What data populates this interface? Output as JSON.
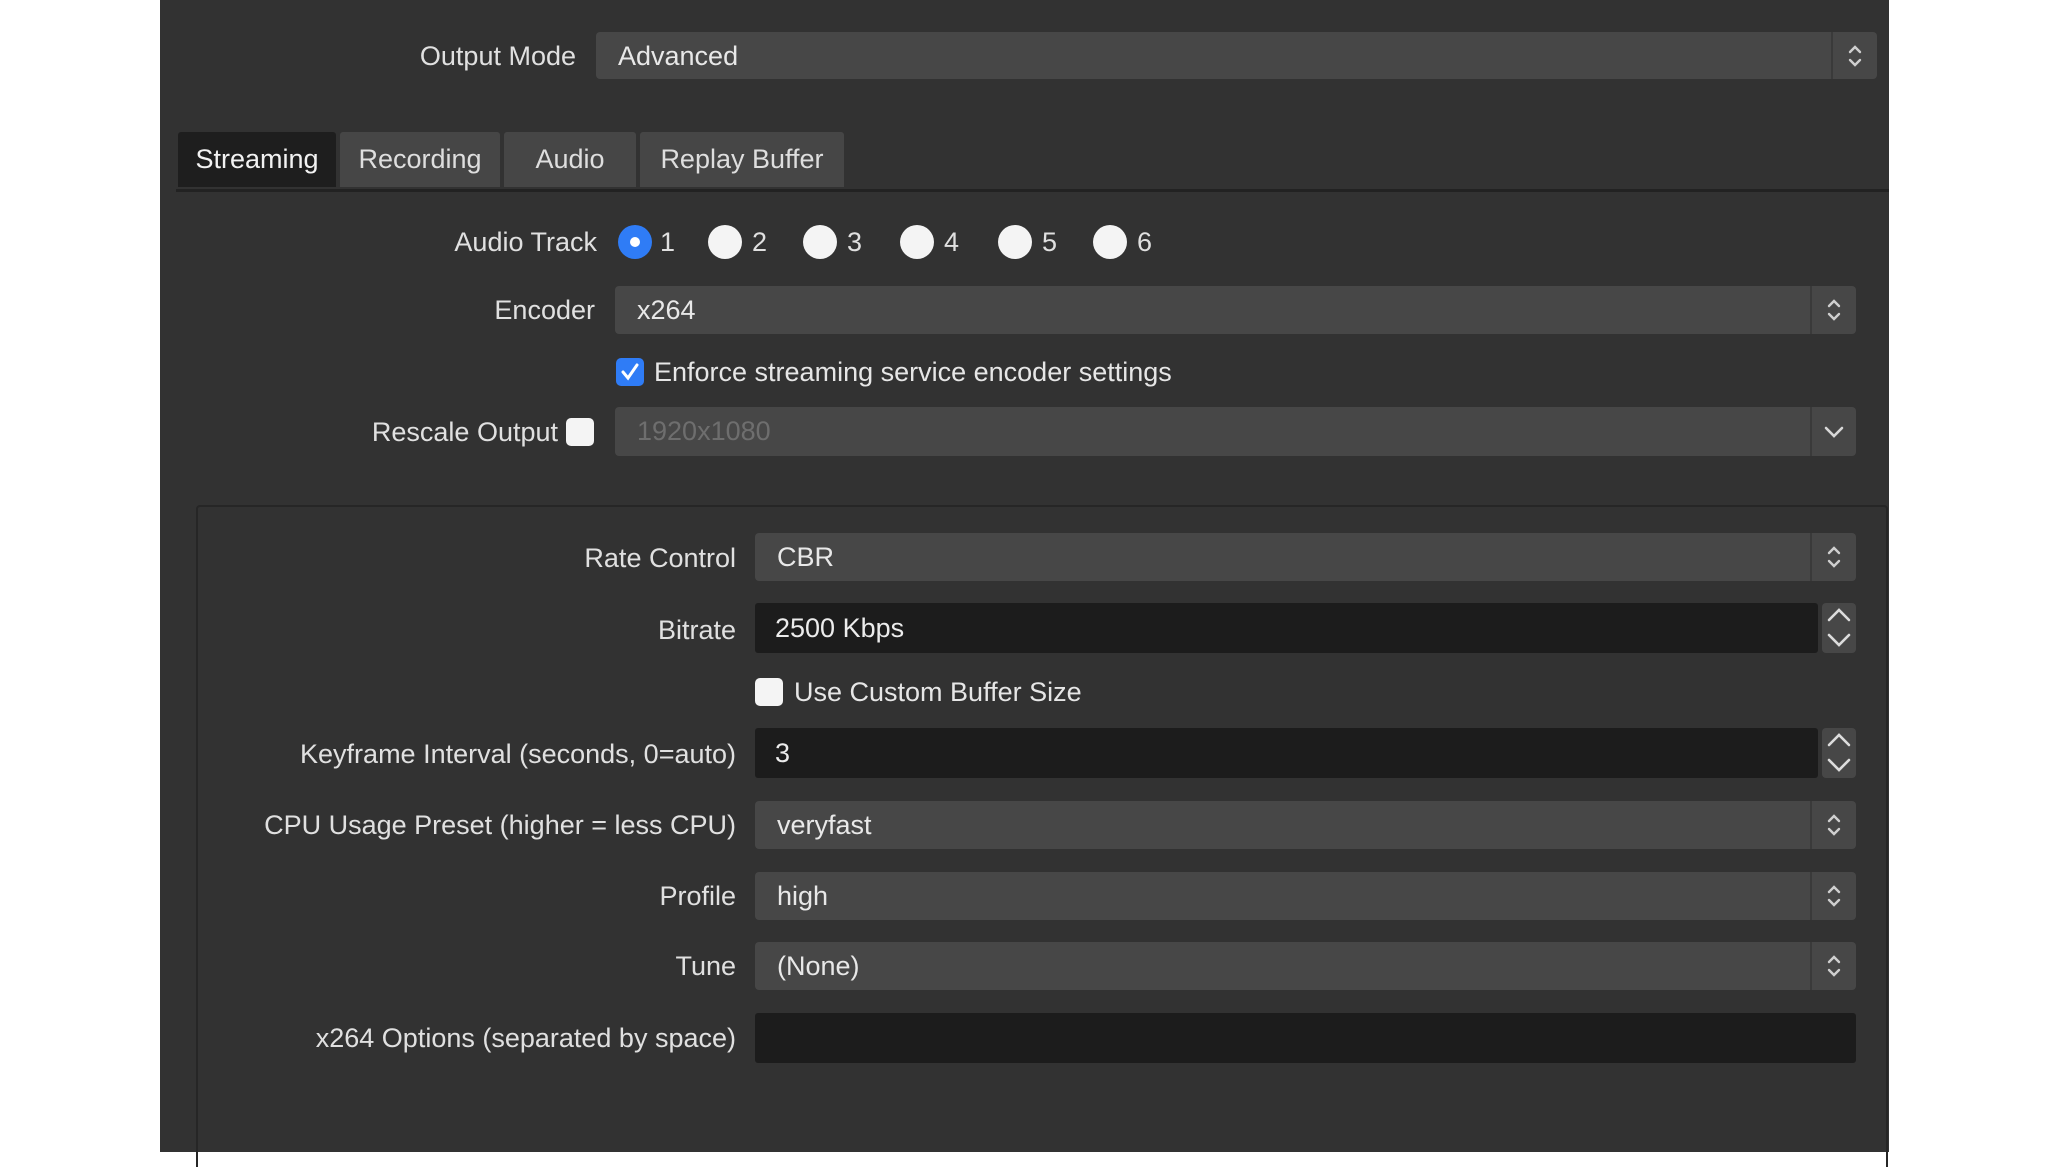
{
  "output_mode": {
    "label": "Output Mode",
    "value": "Advanced"
  },
  "tabs": [
    {
      "label": "Streaming",
      "active": true
    },
    {
      "label": "Recording",
      "active": false
    },
    {
      "label": "Audio",
      "active": false
    },
    {
      "label": "Replay Buffer",
      "active": false
    }
  ],
  "streaming": {
    "audio_track": {
      "label": "Audio Track",
      "options": [
        "1",
        "2",
        "3",
        "4",
        "5",
        "6"
      ],
      "selected": "1"
    },
    "encoder": {
      "label": "Encoder",
      "value": "x264"
    },
    "enforce": {
      "label": "Enforce streaming service encoder settings",
      "checked": true
    },
    "rescale": {
      "label": "Rescale Output",
      "checked": false,
      "value": "1920x1080"
    },
    "rate_control": {
      "label": "Rate Control",
      "value": "CBR"
    },
    "bitrate": {
      "label": "Bitrate",
      "value": "2500 Kbps"
    },
    "custom_buffer": {
      "label": "Use Custom Buffer Size",
      "checked": false
    },
    "keyframe": {
      "label": "Keyframe Interval (seconds, 0=auto)",
      "value": "3"
    },
    "cpu_preset": {
      "label": "CPU Usage Preset (higher = less CPU)",
      "value": "veryfast"
    },
    "profile": {
      "label": "Profile",
      "value": "high"
    },
    "tune": {
      "label": "Tune",
      "value": "(None)"
    },
    "x264_options": {
      "label": "x264 Options (separated by space)",
      "value": ""
    }
  },
  "colors": {
    "accent": "#2f7cf6",
    "background": "#323232",
    "field": "#474747",
    "input": "#1c1c1c"
  }
}
